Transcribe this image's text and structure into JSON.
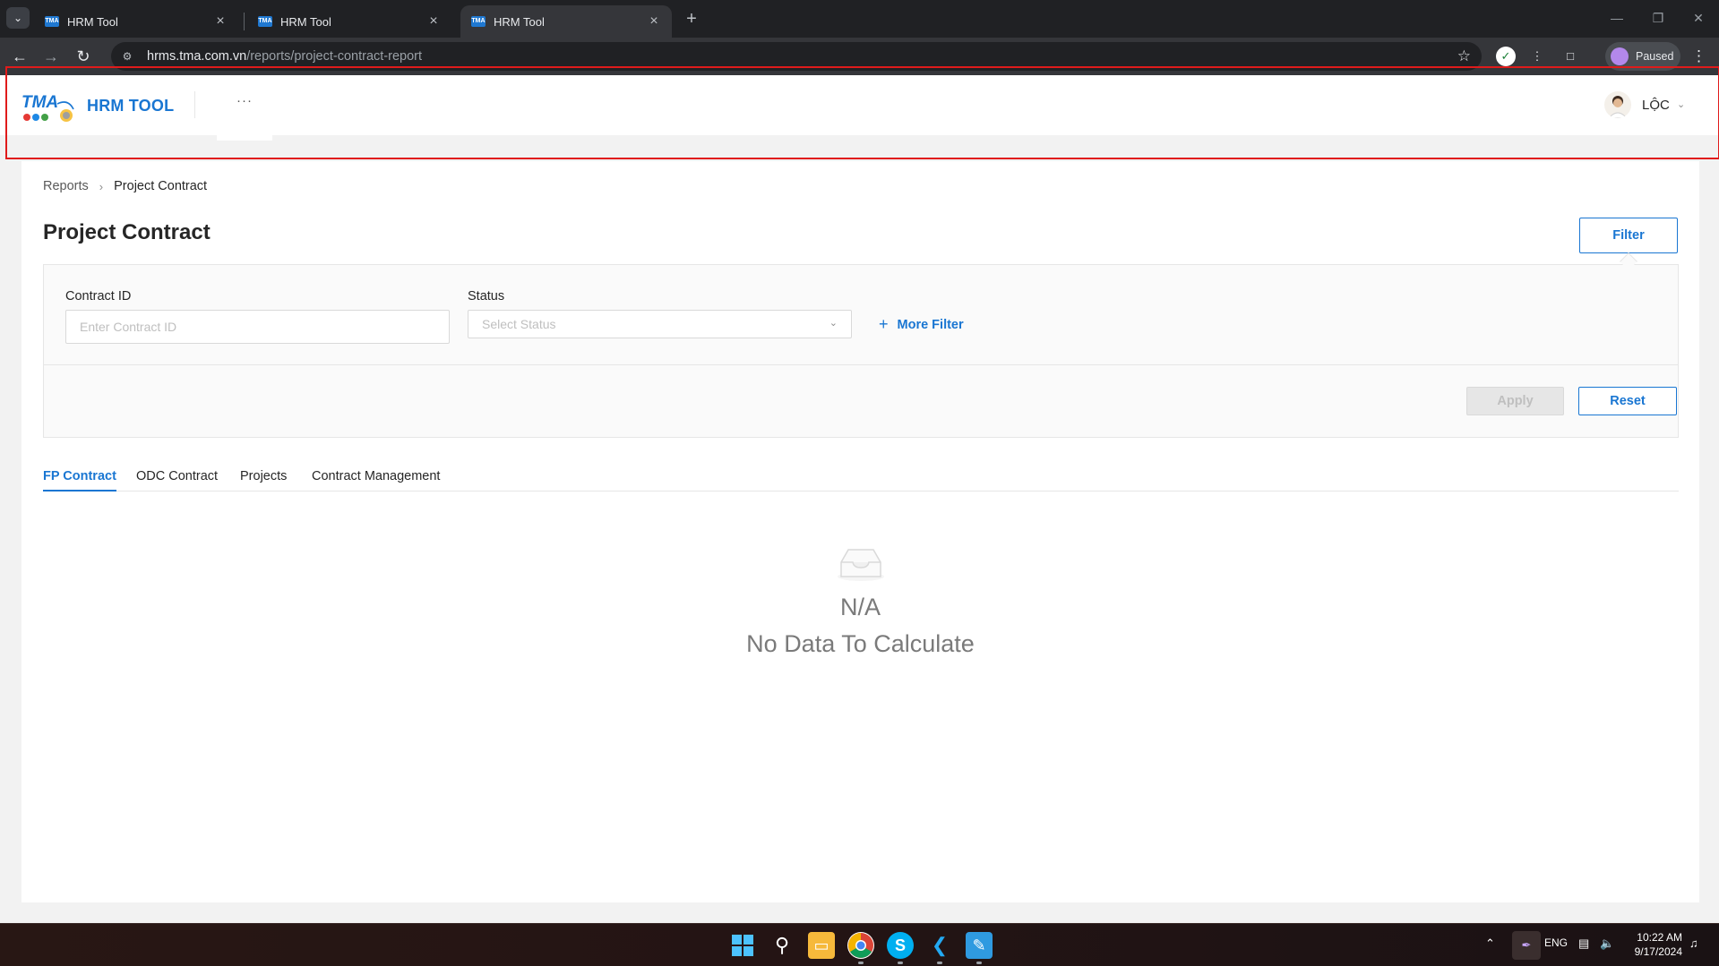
{
  "browser": {
    "tabs": [
      {
        "title": "HRM Tool",
        "favicon": "TMA",
        "active": false
      },
      {
        "title": "HRM Tool",
        "favicon": "TMA",
        "active": false
      },
      {
        "title": "HRM Tool",
        "favicon": "TMA",
        "active": true
      }
    ],
    "url_host": "hrms.tma.com.vn",
    "url_path": "/reports/project-contract-report",
    "profile_label": "Paused"
  },
  "header": {
    "logo_text": "TMA",
    "brand": "HRM TOOL",
    "more": "···",
    "user_name": "LỘC"
  },
  "breadcrumb": {
    "root": "Reports",
    "current": "Project Contract"
  },
  "page": {
    "title": "Project Contract",
    "filter_button": "Filter"
  },
  "filters": {
    "contract_id_label": "Contract ID",
    "contract_id_placeholder": "Enter Contract ID",
    "status_label": "Status",
    "status_placeholder": "Select Status",
    "more_filter": "More Filter",
    "apply": "Apply",
    "reset": "Reset"
  },
  "tabs": [
    {
      "label": "FP Contract",
      "active": true
    },
    {
      "label": "ODC Contract",
      "active": false
    },
    {
      "label": "Projects",
      "active": false
    },
    {
      "label": "Contract Management",
      "active": false
    }
  ],
  "empty_state": {
    "value": "N/A",
    "message": "No Data To Calculate"
  },
  "taskbar": {
    "language": "ENG",
    "time": "10:22 AM",
    "date": "9/17/2024"
  },
  "colors": {
    "accent": "#1976d2",
    "highlight": "#e01b1b"
  }
}
